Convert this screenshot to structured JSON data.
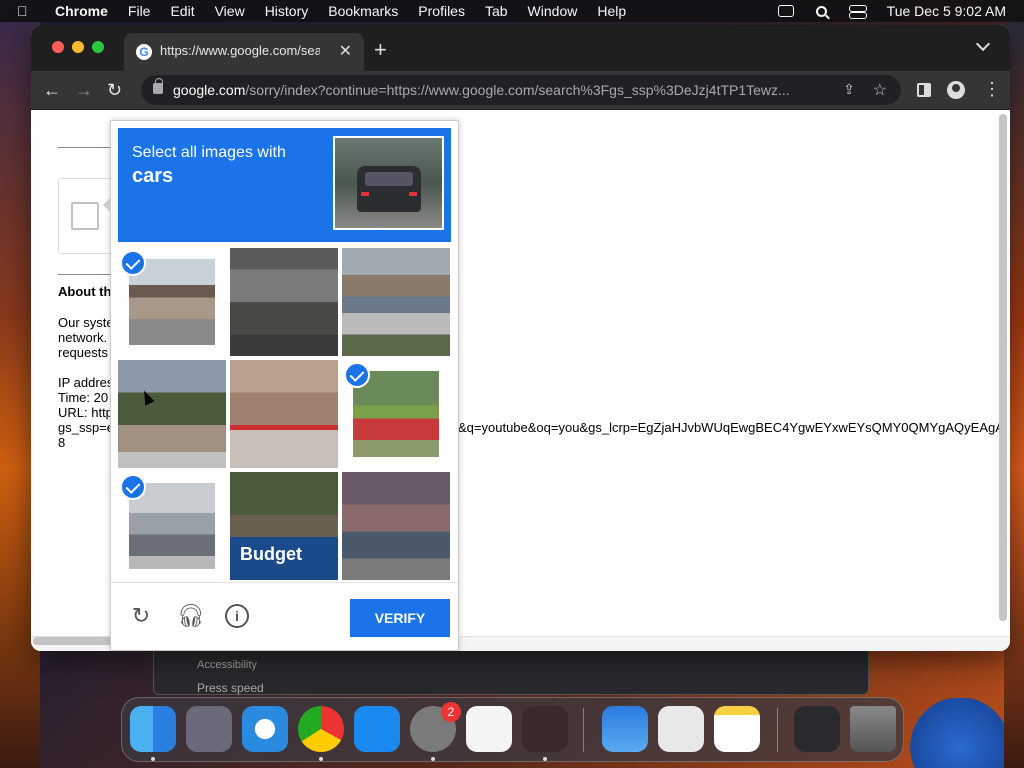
{
  "menubar": {
    "app_name": "Chrome",
    "items": [
      "File",
      "Edit",
      "View",
      "History",
      "Bookmarks",
      "Profiles",
      "Tab",
      "Window",
      "Help"
    ],
    "clock": "Tue Dec 5  9:02 AM"
  },
  "browser": {
    "tab_title": "https://www.google.com/sear",
    "favicon": "G",
    "url_host": "google.com",
    "url_path": "/sorry/index?continue=https://www.google.com/search%3Fgs_ssp%3DeJzj4tTP1Tewz..."
  },
  "page": {
    "about_heading": "About th",
    "para_lines": [
      "Our syste",
      "network.",
      "requests"
    ],
    "ip_line": "IP addres",
    "time_line": "Time: 20",
    "url_line": "URL: http",
    "gs_line": "gs_ssp=e",
    "eight": "8",
    "url_tail": "&q=youtube&oq=you&gs_lcrp=EgZjaHJvbWUqEwgBEC4YgwEYxwEYsQMY0QMYgAQyEAgA"
  },
  "captcha": {
    "prompt_line1": "Select all images with",
    "prompt_line2": "cars",
    "verify_label": "VERIFY",
    "tiles": [
      {
        "id": "tile-1",
        "selected": true
      },
      {
        "id": "tile-2",
        "selected": false
      },
      {
        "id": "tile-3",
        "selected": false
      },
      {
        "id": "tile-4",
        "selected": false
      },
      {
        "id": "tile-5",
        "selected": false
      },
      {
        "id": "tile-6",
        "selected": true
      },
      {
        "id": "tile-7",
        "selected": true
      },
      {
        "id": "tile-8",
        "selected": false,
        "sign_text": "Budget"
      },
      {
        "id": "tile-9",
        "selected": false
      }
    ]
  },
  "background": {
    "text1": "Accessibility",
    "text2": "Press speed"
  },
  "dock": {
    "settings_badge": "2"
  }
}
